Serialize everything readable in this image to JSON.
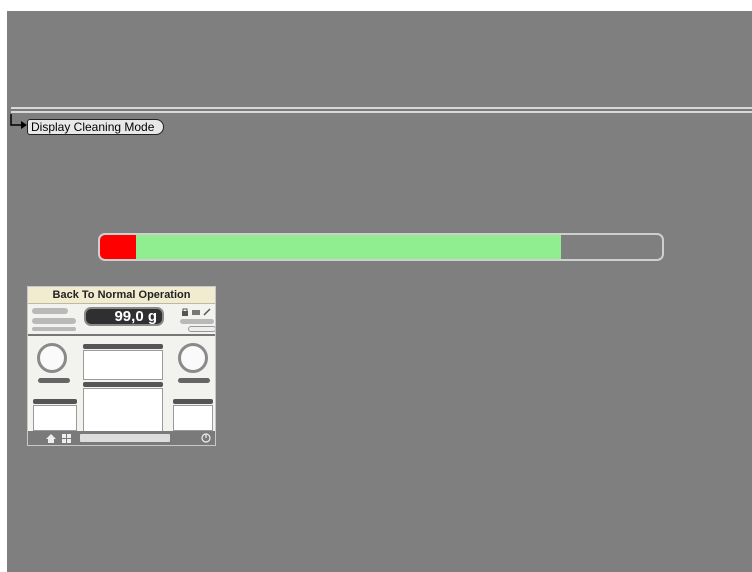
{
  "toolbar": {
    "cleaning_mode_label": "Display Cleaning Mode"
  },
  "progress": {
    "red_fraction": 0.064,
    "green_fraction": 0.82,
    "colors": {
      "red": "#ff0000",
      "green": "#90ee90",
      "track": "#7f7f7f"
    }
  },
  "thumbnail": {
    "title": "Back To Normal Operation",
    "weight_value": "99,0 g"
  },
  "icons": [
    "arrow-right-icon",
    "lock-icon",
    "home-icon",
    "grid-icon",
    "power-icon"
  ]
}
